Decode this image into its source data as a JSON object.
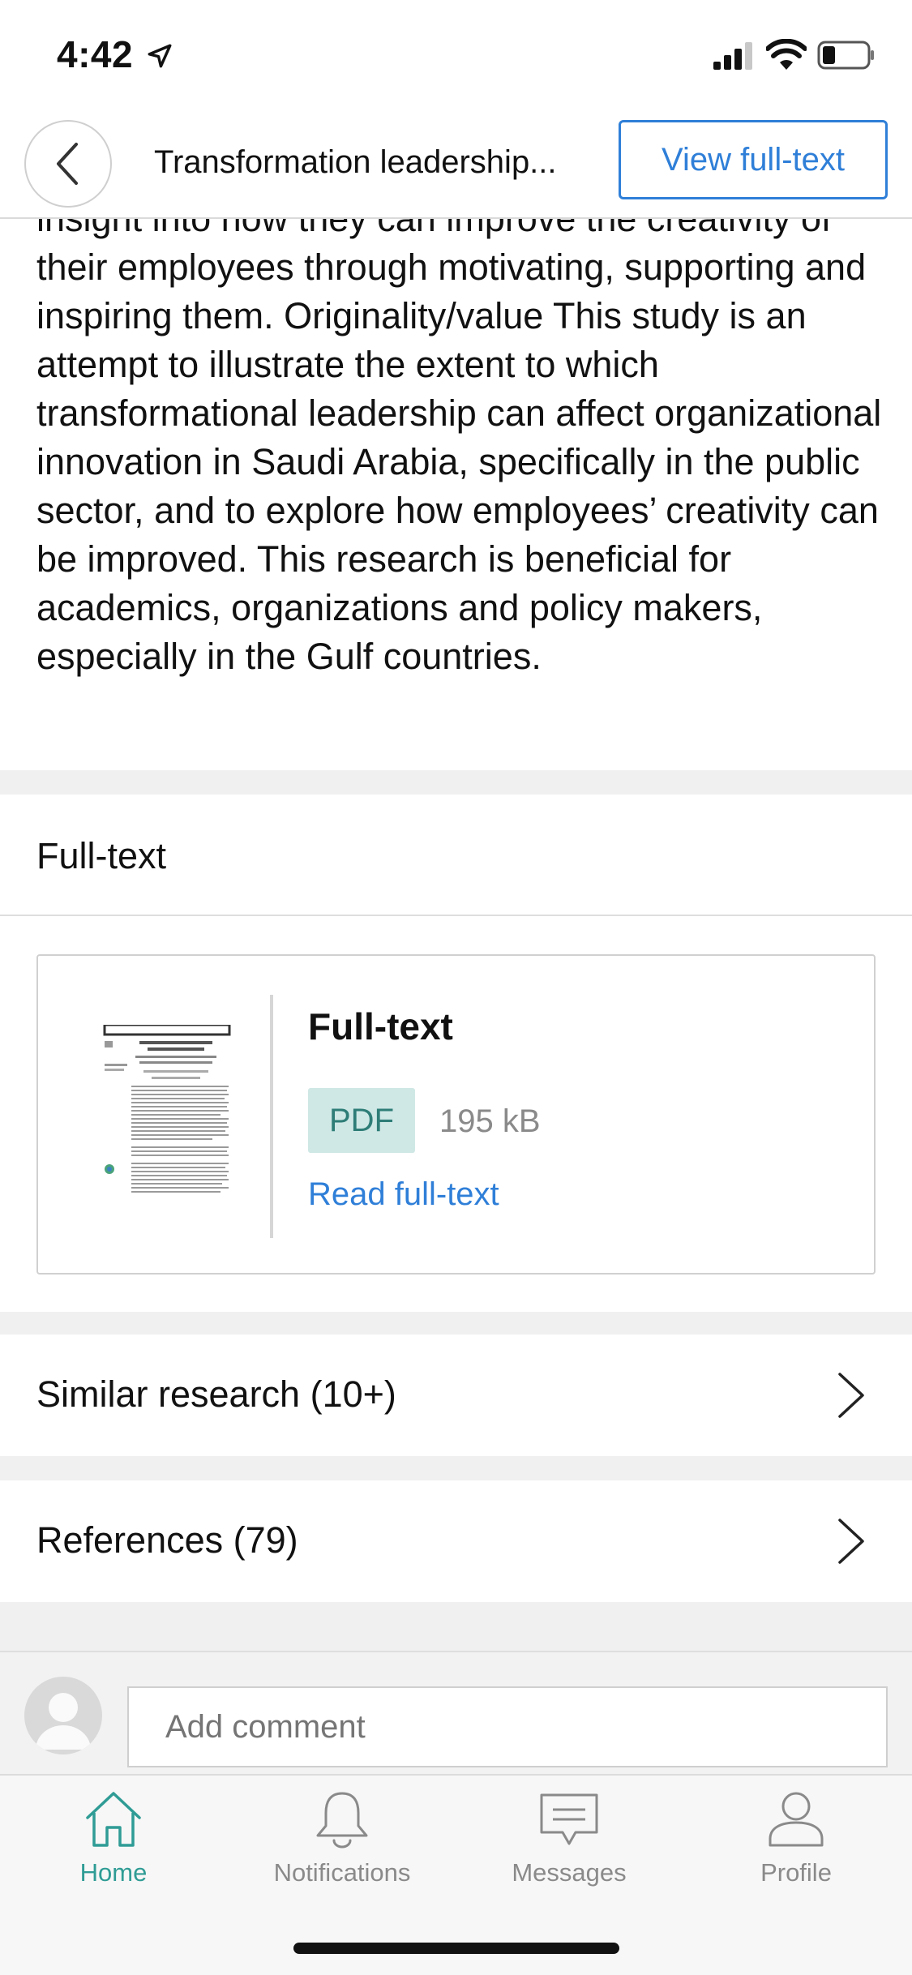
{
  "status_bar": {
    "time": "4:42"
  },
  "header": {
    "title": "Transformation leadership...",
    "view_button": "View full-text"
  },
  "abstract": {
    "text": "insight into how they can improve the creativity of their employees through motivating, supporting and inspiring them.  Originality/value This study is an attempt to illustrate the extent to which transformational leadership can affect organizational innovation in Saudi Arabia, specifically in the public sector, and to explore how employees’ creativity can be improved. This research is beneficial for academics, organizations and policy makers, especially in the Gulf countries."
  },
  "fulltext_section": {
    "heading": "Full-text",
    "card": {
      "title": "Full-text",
      "badge": "PDF",
      "size": "195 kB",
      "link": "Read full-text"
    }
  },
  "similar_research": {
    "label": "Similar research (10+)"
  },
  "references": {
    "label": "References (79)"
  },
  "comment": {
    "placeholder": "Add comment"
  },
  "tabs": [
    {
      "label": "Home",
      "icon": "home-icon",
      "active": true
    },
    {
      "label": "Notifications",
      "icon": "bell-icon",
      "active": false
    },
    {
      "label": "Messages",
      "icon": "message-icon",
      "active": false
    },
    {
      "label": "Profile",
      "icon": "profile-icon",
      "active": false
    }
  ],
  "colors": {
    "accent_blue": "#2f7fd8",
    "accent_teal": "#2f9c95",
    "badge_bg": "#cfe8e6"
  }
}
